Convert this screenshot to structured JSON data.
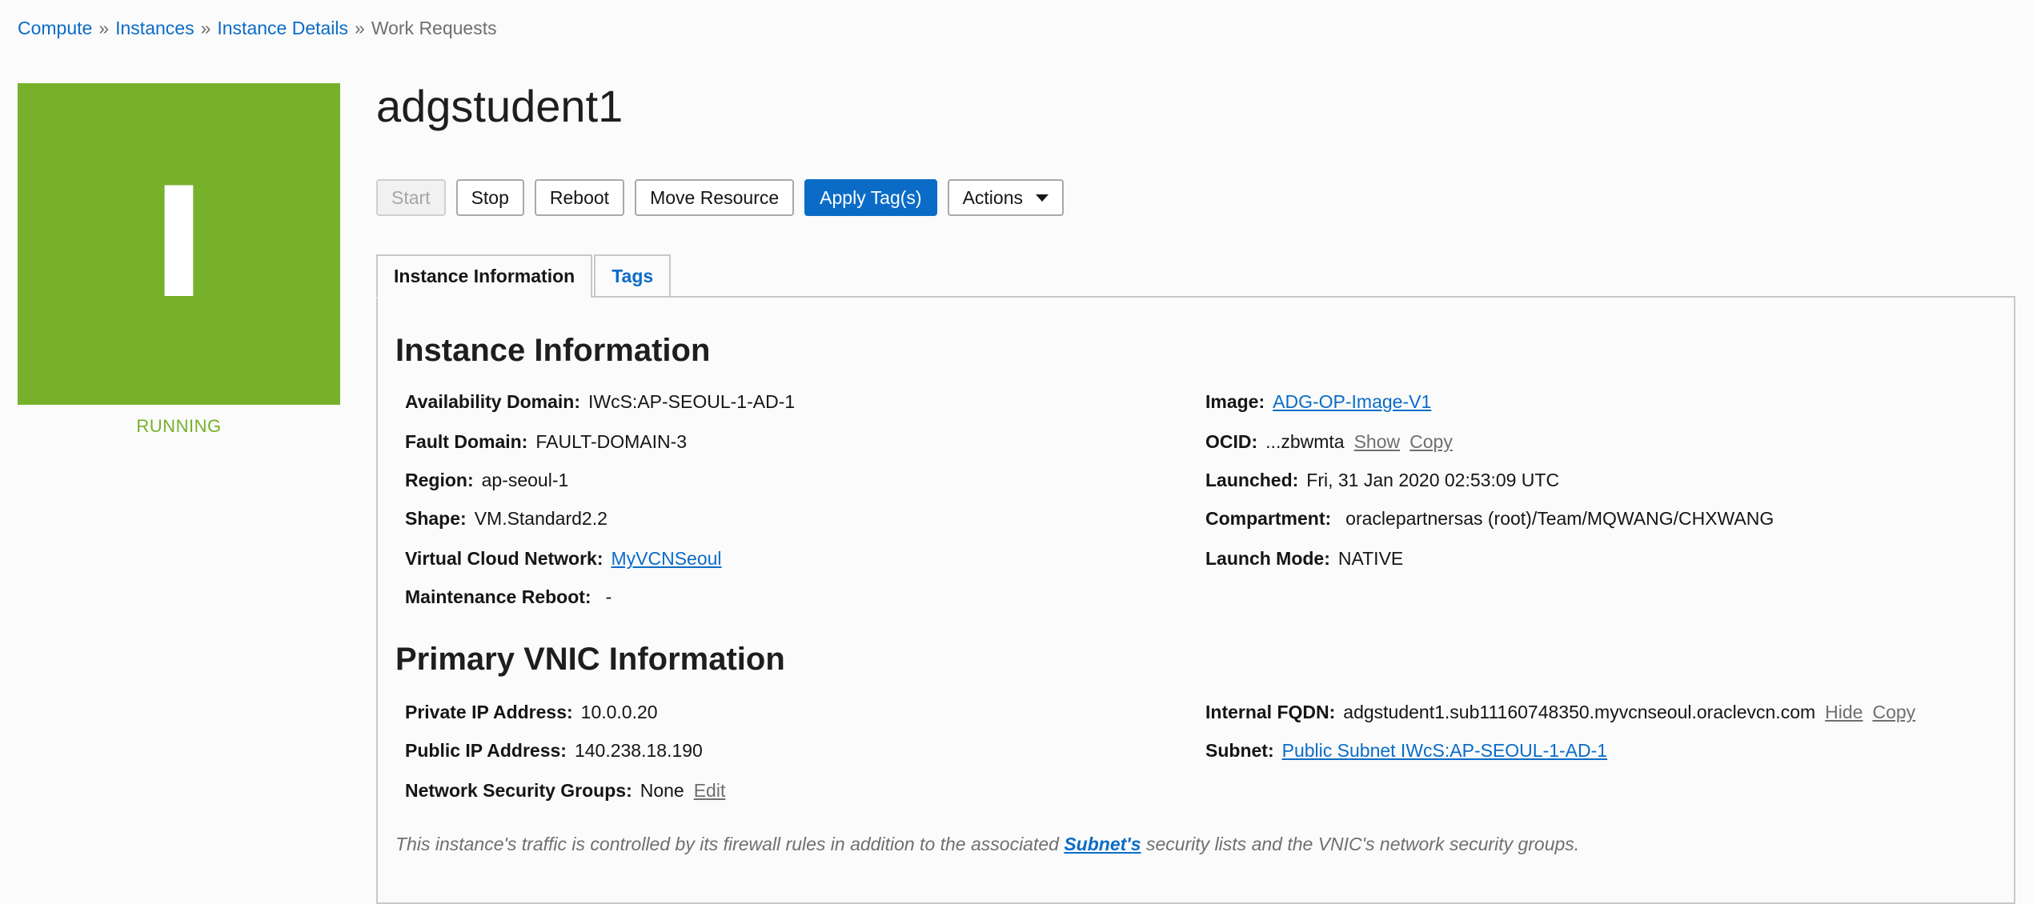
{
  "breadcrumb": {
    "items": [
      "Compute",
      "Instances",
      "Instance Details"
    ],
    "separator": "»",
    "current": "Work Requests"
  },
  "status": {
    "glyph": "I",
    "text": "RUNNING",
    "color": "#77b12b"
  },
  "instance": {
    "name": "adgstudent1"
  },
  "toolbar": {
    "start": "Start",
    "stop": "Stop",
    "reboot": "Reboot",
    "move": "Move Resource",
    "apply_tags": "Apply Tag(s)",
    "actions": "Actions"
  },
  "tabs": {
    "info": "Instance Information",
    "tags": "Tags"
  },
  "instance_info": {
    "title": "Instance Information",
    "left": {
      "availability_domain": {
        "label": "Availability Domain:",
        "value": "IWcS:AP-SEOUL-1-AD-1"
      },
      "fault_domain": {
        "label": "Fault Domain:",
        "value": "FAULT-DOMAIN-3"
      },
      "region": {
        "label": "Region:",
        "value": "ap-seoul-1"
      },
      "shape": {
        "label": "Shape:",
        "value": "VM.Standard2.2"
      },
      "vcn": {
        "label": "Virtual Cloud Network:",
        "value": "MyVCNSeoul"
      },
      "maintenance_reboot": {
        "label": "Maintenance Reboot:",
        "value": "-"
      }
    },
    "right": {
      "image": {
        "label": "Image:",
        "value": "ADG-OP-Image-V1"
      },
      "ocid": {
        "label": "OCID:",
        "value": "...zbwmta",
        "show": "Show",
        "copy": "Copy"
      },
      "launched": {
        "label": "Launched:",
        "value": "Fri, 31 Jan 2020 02:53:09 UTC"
      },
      "compartment": {
        "label": "Compartment:",
        "value": "oraclepartnersas (root)/Team/MQWANG/CHXWANG"
      },
      "launch_mode": {
        "label": "Launch Mode:",
        "value": "NATIVE"
      }
    }
  },
  "vnic_info": {
    "title": "Primary VNIC Information",
    "left": {
      "private_ip": {
        "label": "Private IP Address:",
        "value": "10.0.0.20"
      },
      "public_ip": {
        "label": "Public IP Address:",
        "value": "140.238.18.190"
      },
      "nsg": {
        "label": "Network Security Groups:",
        "value": "None",
        "edit": "Edit"
      }
    },
    "right": {
      "fqdn": {
        "label": "Internal FQDN:",
        "value": "adgstudent1.sub11160748350.myvcnseoul.oraclevcn.com",
        "hide": "Hide",
        "copy": "Copy"
      },
      "subnet": {
        "label": "Subnet:",
        "value": "Public Subnet IWcS:AP-SEOUL-1-AD-1"
      }
    }
  },
  "note": {
    "prefix": "This instance's traffic is controlled by its firewall rules in addition to the associated",
    "link": "Subnet's",
    "suffix": "security lists and the VNIC's network security groups."
  },
  "colors": {
    "accent": "#0b6cc7",
    "running": "#77b12b"
  }
}
